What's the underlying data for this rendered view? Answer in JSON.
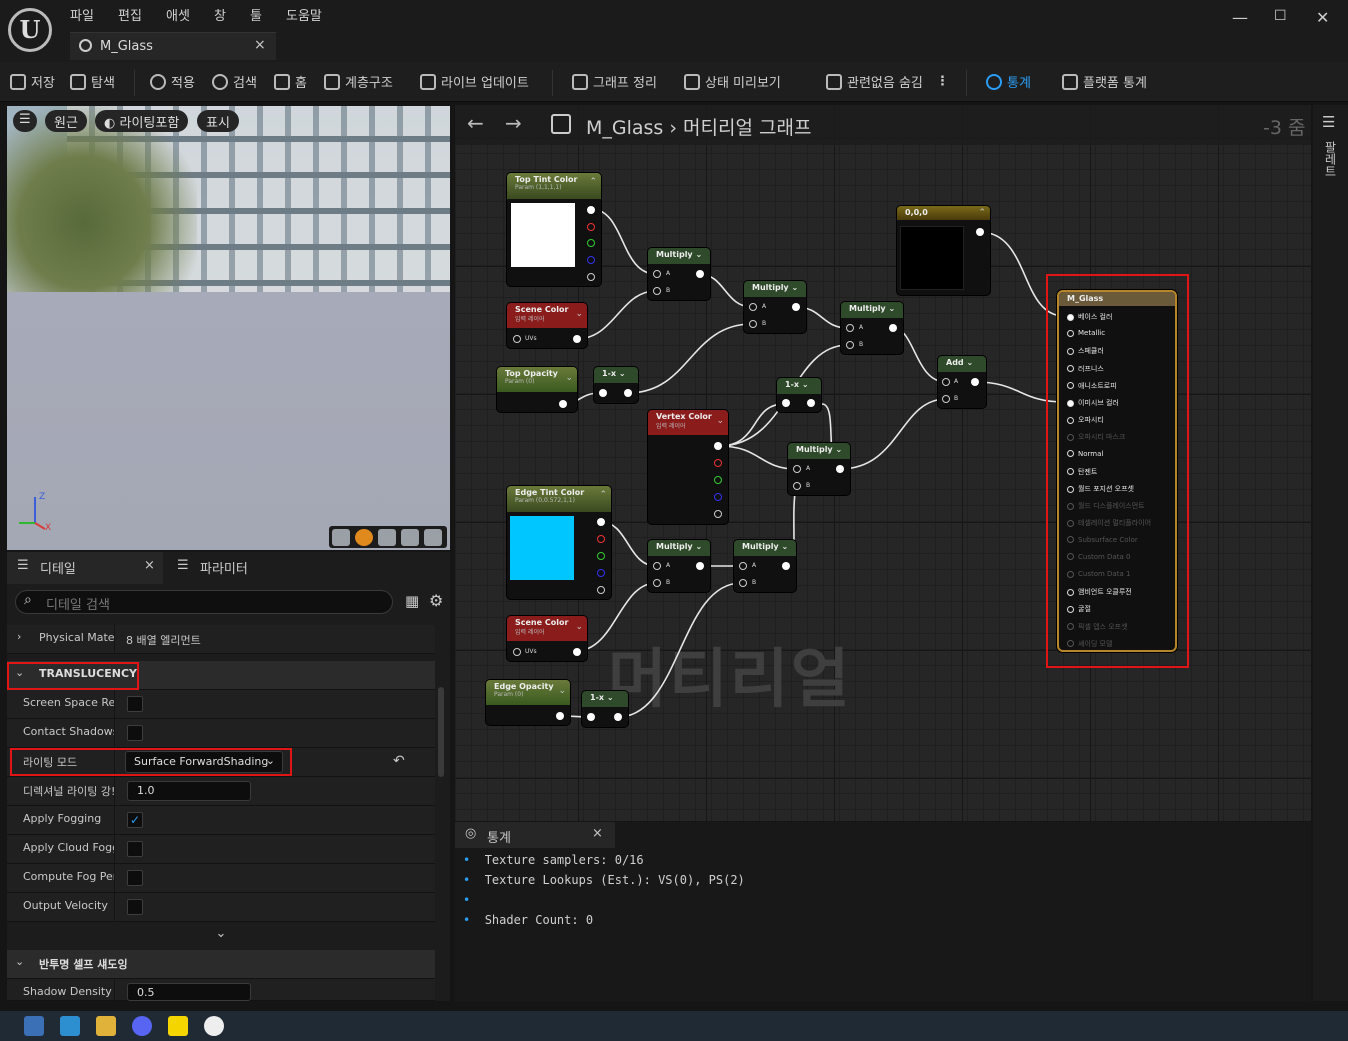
{
  "app": {
    "logo": "unreal-logo-icon",
    "menu": [
      "파일",
      "편집",
      "애셋",
      "창",
      "툴",
      "도움말"
    ],
    "tab": "M_Glass"
  },
  "window": {
    "minimize": "—",
    "maximize": "☐",
    "close": "✕"
  },
  "toolbar": {
    "save": "저장",
    "browse": "탐색",
    "apply": "적용",
    "search": "검색",
    "home": "홈",
    "hierarchy": "계층구조",
    "live_update": "라이브 업데이트",
    "clean_graph": "그래프 정리",
    "preview_state": "상태 미리보기",
    "hide_unrelated": "관련없음 숨김",
    "stats": "통계",
    "platform_stats": "플랫폼 통계"
  },
  "viewport": {
    "perspective": "원근",
    "lit": "라이팅포함",
    "show": "표시"
  },
  "details": {
    "tab_details": "디테일",
    "tab_params": "파라미터",
    "search_placeholder": "디테일 검색",
    "physical_material_key": "Physical Mater",
    "physical_material_val": "8 배열 엘리먼트",
    "translucency_header": "TRANSLUCENCY",
    "screen_space_refl": "Screen Space Ref",
    "contact_shadows": "Contact Shadows",
    "lighting_mode_key": "라이팅 모드",
    "lighting_mode_val": "Surface ForwardShading",
    "directional_key": "디렉셔널 라이팅 강!",
    "directional_val": "1.0",
    "apply_fogging": "Apply Fogging",
    "apply_fogging_checked": true,
    "apply_cloud": "Apply Cloud Foggi",
    "compute_fog": "Compute Fog Per",
    "output_velocity": "Output Velocity",
    "self_shadow_header": "반투명 셀프 섀도잉",
    "shadow_density_key": "Shadow Density S",
    "shadow_density_val": "0.5"
  },
  "graph": {
    "breadcrumb": "M_Glass",
    "graph_name": "머티리얼 그래프",
    "zoom": "-3 줌",
    "watermark": "머티리얼"
  },
  "nodes": {
    "top_tint": {
      "title": "Top Tint Color",
      "sub": "Param (1,1,1,1)",
      "swatch": "#ffffff"
    },
    "scene1": {
      "title": "Scene Color",
      "sub": "입력 레이어",
      "uvs": "UVs"
    },
    "top_opacity": {
      "title": "Top Opacity",
      "sub": "Param (0)"
    },
    "oneminus1": "1-x",
    "oneminus2": "1-x",
    "oneminus3": "1-x",
    "mul1": "Multiply",
    "mul2": "Multiply",
    "mul3": "Multiply",
    "mul4": "Multiply",
    "mul5": "Multiply",
    "mul6": "Multiply",
    "pin_a": "A",
    "pin_b": "B",
    "const": {
      "title": "0,0,0",
      "swatch": "#000000"
    },
    "add": "Add",
    "vertex": {
      "title": "Vertex Color",
      "sub": "입력 레이어"
    },
    "edge_tint": {
      "title": "Edge Tint Color",
      "sub": "Param (0,0.572,1,1)",
      "swatch": "#00c6ff"
    },
    "scene2": {
      "title": "Scene Color",
      "sub": "입력 레이어",
      "uvs": "UVs"
    },
    "edge_opacity": {
      "title": "Edge Opacity",
      "sub": "Param (0)"
    },
    "result": {
      "title": "M_Glass",
      "inputs": [
        {
          "label": "베이스 컬러",
          "on": true
        },
        {
          "label": "Metallic",
          "on": true
        },
        {
          "label": "스페큘러",
          "on": true
        },
        {
          "label": "러프니스",
          "on": true
        },
        {
          "label": "애니소트로피",
          "on": true
        },
        {
          "label": "이미시브 컬러",
          "on": true
        },
        {
          "label": "오파시티",
          "on": true
        },
        {
          "label": "오파시티 마스크",
          "on": false
        },
        {
          "label": "Normal",
          "on": true
        },
        {
          "label": "탄젠트",
          "on": true
        },
        {
          "label": "월드 포지션 오프셋",
          "on": true
        },
        {
          "label": "월드 디스플레이스먼트",
          "on": false
        },
        {
          "label": "테셀레이션 멀티플라이어",
          "on": false
        },
        {
          "label": "Subsurface Color",
          "on": false
        },
        {
          "label": "Custom Data 0",
          "on": false
        },
        {
          "label": "Custom Data 1",
          "on": false
        },
        {
          "label": "앰비언트 오클루전",
          "on": true
        },
        {
          "label": "굴절",
          "on": true
        },
        {
          "label": "픽셀 뎁스 오프셋",
          "on": false
        },
        {
          "label": "셰이딩 모델",
          "on": false
        }
      ]
    }
  },
  "palette": {
    "label": "팔레트"
  },
  "stats": {
    "tab": "통계",
    "lines": [
      "Texture samplers: 0/16",
      "Texture Lookups (Est.): VS(0), PS(2)",
      "",
      "Shader Count: 0"
    ]
  },
  "colors": {
    "accent": "#2a9df4",
    "highlight": "#e01515",
    "param_header": "#4c6a2e",
    "scene_header": "#8a1c1c",
    "math_header": "#2f4a2a",
    "const_header": "#6a5a1a",
    "result_header": "#6b5a3a"
  }
}
